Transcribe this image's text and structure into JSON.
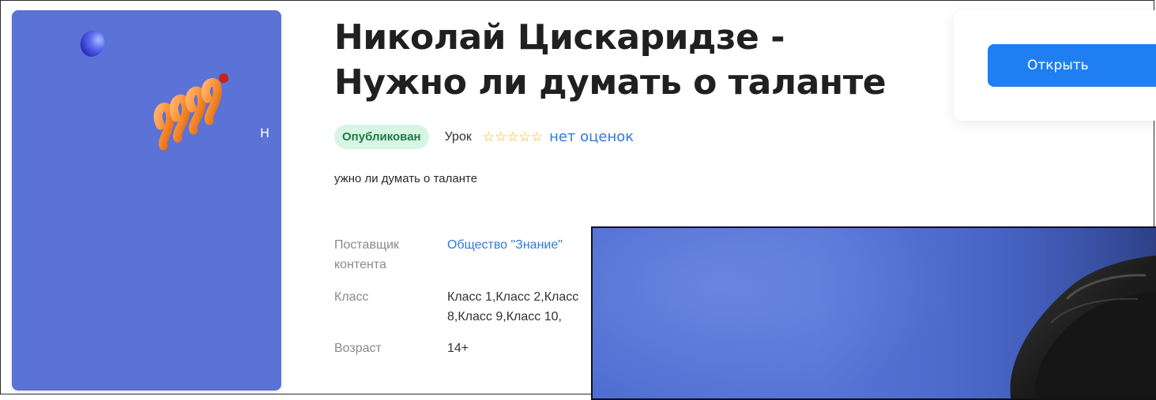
{
  "cover": {
    "letter": "Н",
    "background_color": "#5b72d6"
  },
  "lesson": {
    "title_line1": "Николай Цискаридзе -",
    "title_line2": "Нужно ли думать о таланте",
    "status": "Опубликован",
    "type": "Урок",
    "stars": "☆☆☆☆☆",
    "rating": "нет оценок",
    "description": "ужно ли думать о таланте"
  },
  "details": {
    "provider_label": "Поставщик контента",
    "provider_value": "Общество \"Знание\"",
    "class_label": "Класс",
    "class_value": "Класс 1,Класс 2,Класс 8,Класс 9,Класс 10,",
    "age_label": "Возраст",
    "age_value": "14+"
  },
  "actions": {
    "open_label": "Открыть",
    "accent_color": "#1f7ff2"
  },
  "icons": {
    "cover_ball": "blue-sphere-icon",
    "cover_spring": "orange-spring-icon"
  }
}
